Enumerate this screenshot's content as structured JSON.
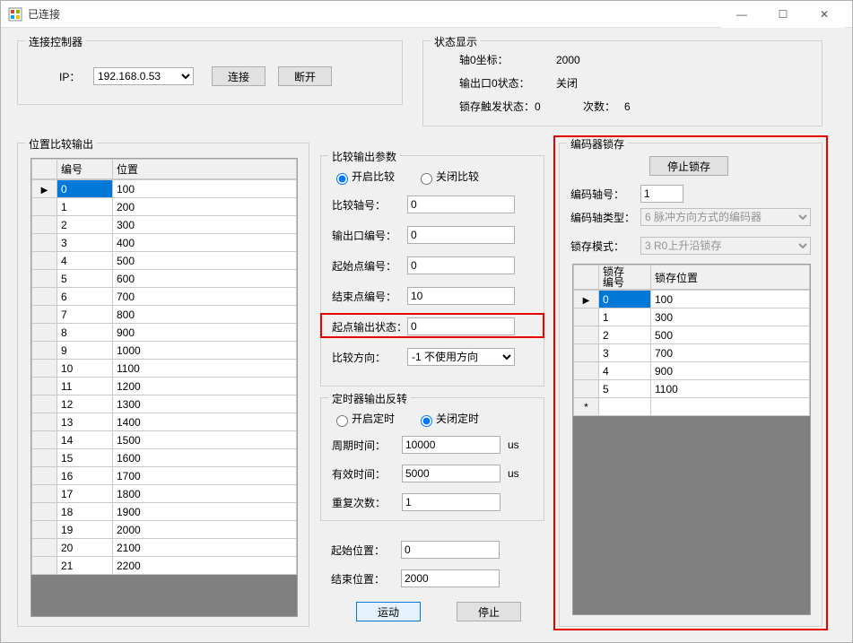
{
  "window": {
    "title": "已连接"
  },
  "winbtn": {
    "min": "—",
    "max": "☐",
    "close": "✕"
  },
  "connect_group": {
    "title": "连接控制器",
    "ip_label": "IP：",
    "ip_value": "192.168.0.53",
    "connect_btn": "连接",
    "disconnect_btn": "断开"
  },
  "status_group": {
    "title": "状态显示",
    "r1_label": "轴0坐标：",
    "r1_value": "2000",
    "r2_label": "输出口0状态：",
    "r2_value": "关闭",
    "r3_label": "锁存触发状态：0",
    "r3b_label": "次数：",
    "r3b_value": "6"
  },
  "pos_group": {
    "title": "位置比较输出",
    "cols": {
      "id": "编号",
      "pos": "位置"
    },
    "rows": [
      {
        "id": "0",
        "pos": "100"
      },
      {
        "id": "1",
        "pos": "200"
      },
      {
        "id": "2",
        "pos": "300"
      },
      {
        "id": "3",
        "pos": "400"
      },
      {
        "id": "4",
        "pos": "500"
      },
      {
        "id": "5",
        "pos": "600"
      },
      {
        "id": "6",
        "pos": "700"
      },
      {
        "id": "7",
        "pos": "800"
      },
      {
        "id": "8",
        "pos": "900"
      },
      {
        "id": "9",
        "pos": "1000"
      },
      {
        "id": "10",
        "pos": "1100"
      },
      {
        "id": "11",
        "pos": "1200"
      },
      {
        "id": "12",
        "pos": "1300"
      },
      {
        "id": "13",
        "pos": "1400"
      },
      {
        "id": "14",
        "pos": "1500"
      },
      {
        "id": "15",
        "pos": "1600"
      },
      {
        "id": "16",
        "pos": "1700"
      },
      {
        "id": "17",
        "pos": "1800"
      },
      {
        "id": "18",
        "pos": "1900"
      },
      {
        "id": "19",
        "pos": "2000"
      },
      {
        "id": "20",
        "pos": "2100"
      },
      {
        "id": "21",
        "pos": "2200"
      }
    ]
  },
  "cmp_group": {
    "title": "比较输出参数",
    "radio_on": "开启比较",
    "radio_off": "关闭比较",
    "axis_label": "比较轴号：",
    "axis_value": "0",
    "outport_label": "输出口编号：",
    "outport_value": "0",
    "startpt_label": "起始点编号：",
    "startpt_value": "0",
    "endpt_label": "结束点编号：",
    "endpt_value": "10",
    "startout_label": "起点输出状态：",
    "startout_value": "0",
    "dir_label": "比较方向：",
    "dir_value": "-1 不使用方向"
  },
  "timer_group": {
    "title": "定时器输出反转",
    "radio_on": "开启定时",
    "radio_off": "关闭定时",
    "cycle_label": "周期时间：",
    "cycle_value": "10000",
    "cycle_unit": "us",
    "eff_label": "有效时间：",
    "eff_value": "5000",
    "eff_unit": "us",
    "rep_label": "重复次数：",
    "rep_value": "1"
  },
  "range": {
    "start_label": "起始位置：",
    "start_value": "0",
    "end_label": "结束位置：",
    "end_value": "2000"
  },
  "run": {
    "run_btn": "运动",
    "stop_btn": "停止"
  },
  "latch_group": {
    "title": "编码器锁存",
    "stop_btn": "停止锁存",
    "axis_label": "编码轴号：",
    "axis_value": "1",
    "type_label": "编码轴类型：",
    "type_value": "6 脉冲方向方式的编码器",
    "mode_label": "锁存模式：",
    "mode_value": "3 R0上升沿锁存",
    "cols": {
      "id": "锁存编号",
      "pos": "锁存位置"
    },
    "id_line1": "锁存",
    "id_line2": "编号",
    "rows": [
      {
        "id": "0",
        "pos": "100"
      },
      {
        "id": "1",
        "pos": "300"
      },
      {
        "id": "2",
        "pos": "500"
      },
      {
        "id": "3",
        "pos": "700"
      },
      {
        "id": "4",
        "pos": "900"
      },
      {
        "id": "5",
        "pos": "1100"
      }
    ]
  }
}
